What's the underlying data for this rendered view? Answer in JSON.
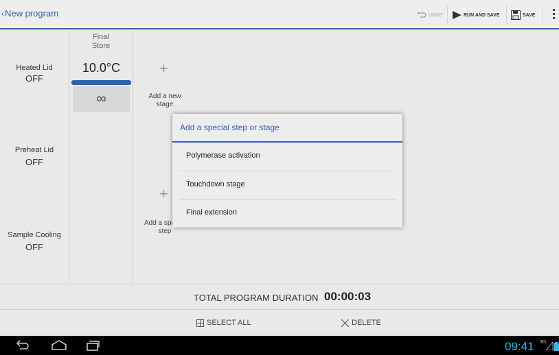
{
  "actionbar": {
    "back_label": "New program",
    "undo_label": "UNDO",
    "run_and_save_label": "RUN AND SAVE",
    "save_label": "SAVE",
    "accent_color": "#2f5fae"
  },
  "program": {
    "side": [
      {
        "label": "Heated Lid",
        "value": "OFF"
      },
      {
        "label": "Preheat Lid",
        "value": "OFF"
      },
      {
        "label": "Sample Cooling",
        "value": "OFF"
      }
    ],
    "stage": {
      "title_line1": "Final",
      "title_line2": "Store",
      "temperature": "10.0°C",
      "time": "∞"
    },
    "add_stage_line1": "Add a new",
    "add_stage_line2": "stage",
    "add_special_line1": "Add a special",
    "add_special_line2": "step"
  },
  "duration": {
    "label": "TOTAL PROGRAM DURATION",
    "value": "00:00:03"
  },
  "bottombar": {
    "select_all_label": "SELECT ALL",
    "delete_label": "DELETE"
  },
  "statusbar": {
    "clock": "09:41",
    "signal_label": "3G",
    "clock_color": "#33b5e5"
  },
  "dialog": {
    "title": "Add a special step or stage",
    "options": [
      "Polymerase activation",
      "Touchdown stage",
      "Final extension"
    ]
  }
}
